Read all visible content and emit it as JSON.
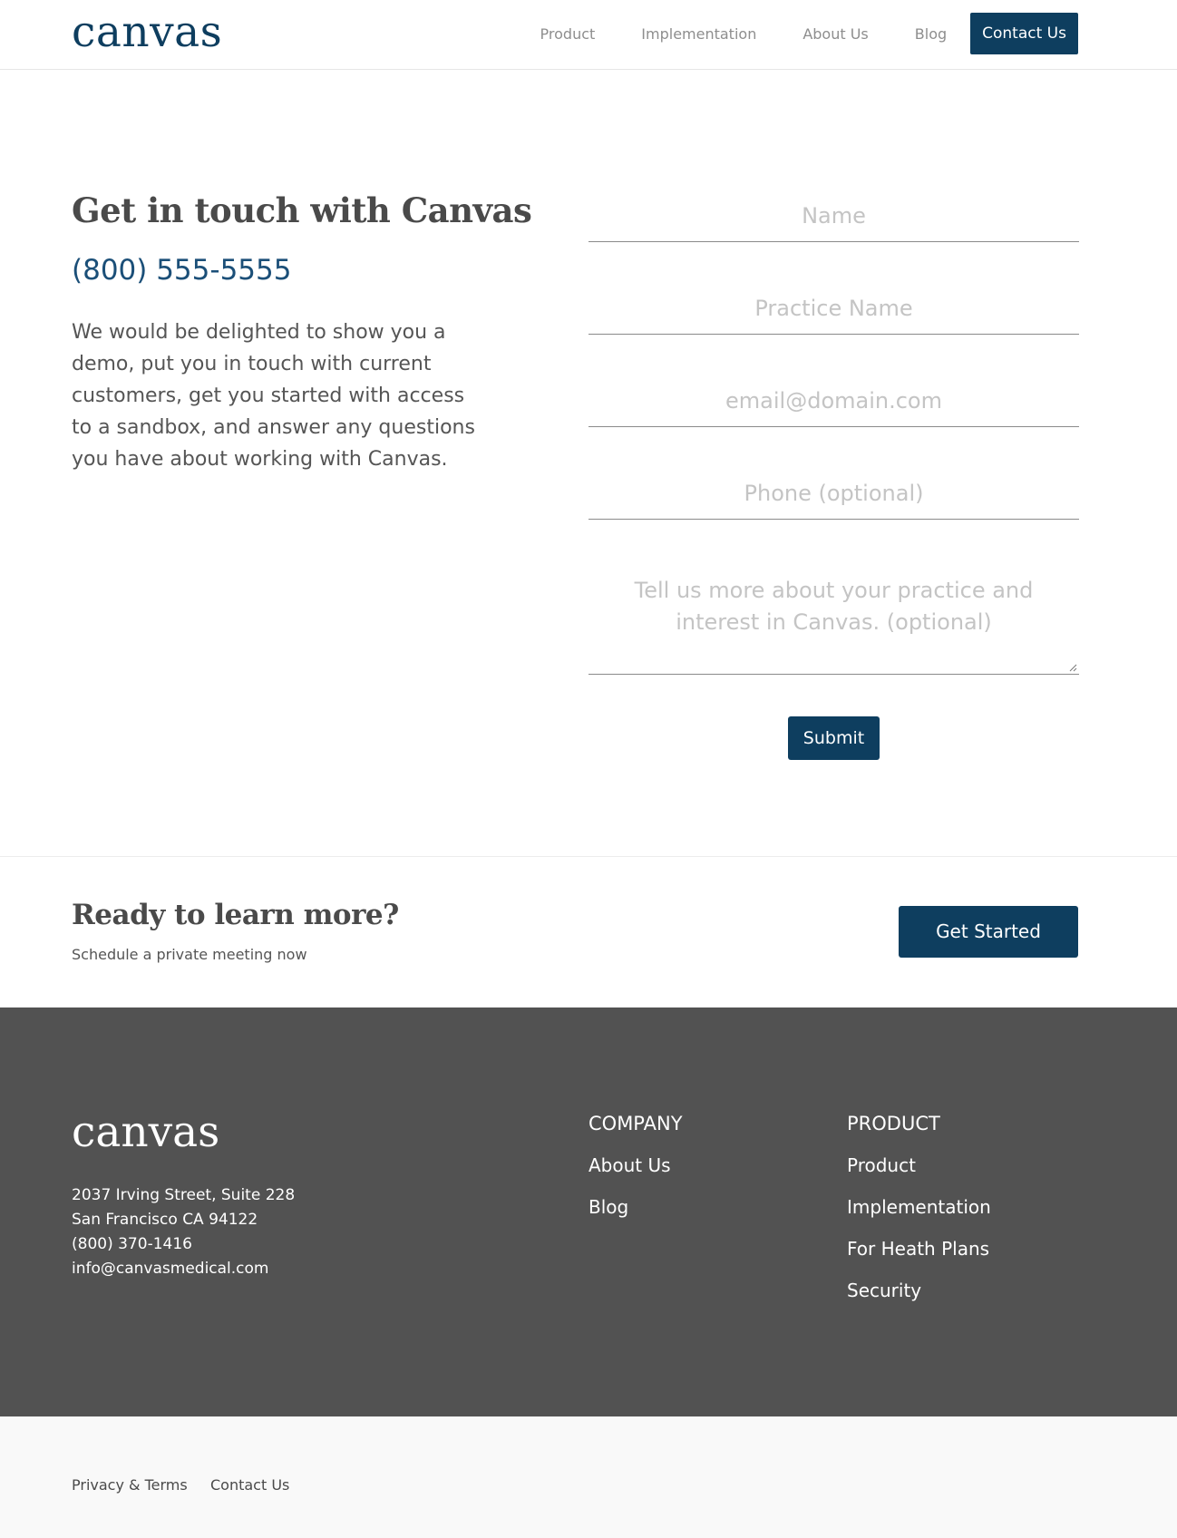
{
  "header": {
    "logo": "canvas",
    "nav": {
      "product": "Product",
      "implementation": "Implementation",
      "about": "About Us",
      "blog": "Blog",
      "contact": "Contact Us"
    }
  },
  "contact": {
    "title": "Get in touch with Canvas",
    "phone": "(800) 555-5555",
    "intro": "We would be delighted to show you a demo, put you in touch with current customers, get you started with access to a sandbox, and answer any questions you have about working with Canvas."
  },
  "form": {
    "name_placeholder": "Name",
    "practice_placeholder": "Practice Name",
    "email_placeholder": "email@domain.com",
    "phone_placeholder": "Phone (optional)",
    "message_placeholder": "Tell us more about your practice and interest in Canvas. (optional)",
    "submit_label": "Submit"
  },
  "cta": {
    "title": "Ready to learn more?",
    "subtitle": "Schedule a private meeting now",
    "button_label": "Get Started"
  },
  "footer": {
    "logo": "canvas",
    "address": {
      "line1": "2037 Irving Street, Suite 228",
      "line2": "San Francisco CA 94122",
      "phone": "(800) 370-1416",
      "email": "info@canvasmedical.com"
    },
    "company": {
      "heading": "COMPANY",
      "links": [
        "About Us",
        "Blog"
      ]
    },
    "product": {
      "heading": "PRODUCT",
      "links": [
        "Product",
        "Implementation",
        "For Heath Plans",
        "Security"
      ]
    }
  },
  "bottom": {
    "privacy": "Privacy & Terms",
    "contact": "Contact Us"
  },
  "colors": {
    "brand": "#0e3e5f",
    "phone_text": "#1b4f78",
    "footer_bg": "#525252",
    "bottom_bg": "#f9f9f9"
  }
}
